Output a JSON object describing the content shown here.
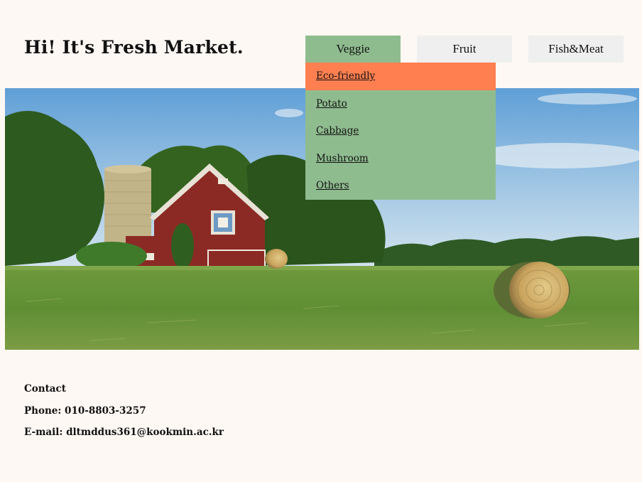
{
  "header": {
    "title": "Hi! It's Fresh Market."
  },
  "nav": {
    "tabs": [
      {
        "label": "Veggie"
      },
      {
        "label": "Fruit"
      },
      {
        "label": "Fish&Meat"
      }
    ],
    "active": "Veggie"
  },
  "dropdown": {
    "items": [
      {
        "label": "Eco-friendly"
      },
      {
        "label": "Potato"
      },
      {
        "label": "Cabbage"
      },
      {
        "label": "Mushroom"
      },
      {
        "label": "Others"
      }
    ],
    "highlighted": "Eco-friendly"
  },
  "hero": {
    "image": "farm-barn-hay-bales"
  },
  "footer": {
    "contact_heading": "Contact",
    "phone": "Phone: 010-8803-3257",
    "email": "E-mail: dltmddus361@kookmin.ac.kr"
  },
  "colors": {
    "background": "#fdf8f4",
    "active_tab": "#8fbc8f",
    "inactive_tab": "#efefef",
    "highlight": "#ff7f50"
  }
}
